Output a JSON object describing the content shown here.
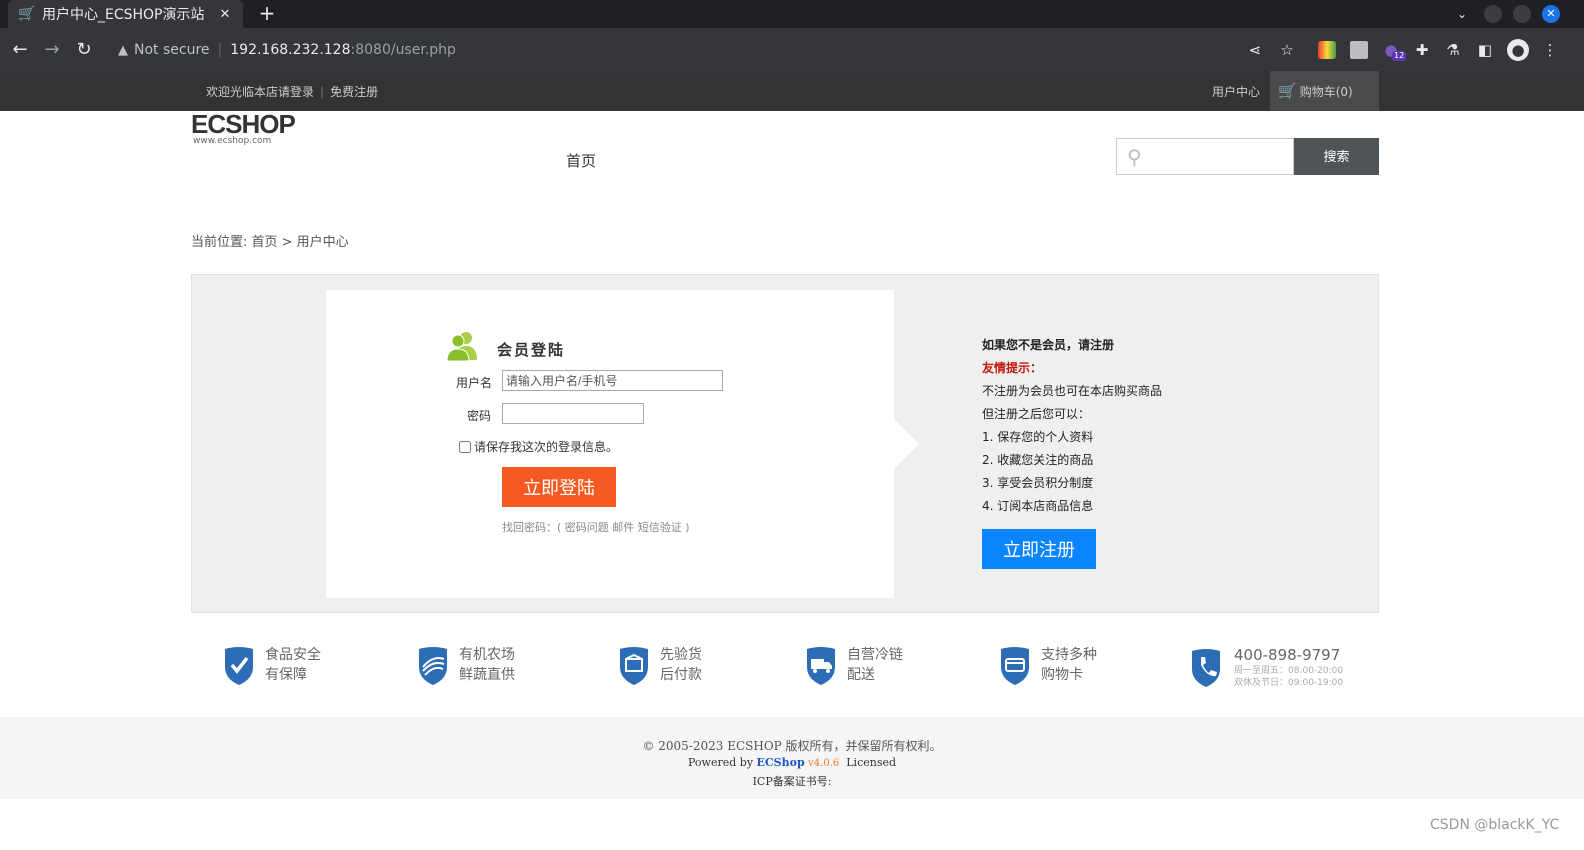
{
  "browser": {
    "tab_title": "用户中心_ECSHOP演示站",
    "security_label": "Not secure",
    "url_host": "192.168.232.128",
    "url_path": ":8080/user.php",
    "extension_badge": "12"
  },
  "site_topbar": {
    "welcome": "欢迎光临本店请登录",
    "register_link": "免费注册",
    "user_center": "用户中心",
    "cart": "购物车(0)"
  },
  "header": {
    "logo_text": "ECSHOP",
    "logo_sub": "www.ecshop.com",
    "nav_home": "首页",
    "search_button": "搜索"
  },
  "breadcrumb": "当前位置: 首页 > 用户中心",
  "login": {
    "title": "会员登陆",
    "username_label": "用户名",
    "username_placeholder": "请输入用户名/手机号",
    "password_label": "密码",
    "remember_label": "请保存我这次的登录信息。",
    "login_button": "立即登陆",
    "forgot": "找回密码：( 密码问题 邮件 短信验证 )"
  },
  "register": {
    "heading": "如果您不是会员，请注册",
    "tip": "友情提示：",
    "lines": [
      "不注册为会员也可在本店购买商品",
      "但注册之后您可以：",
      "1. 保存您的个人资料",
      "2. 收藏您关注的商品",
      "3. 享受会员积分制度",
      "4. 订阅本店商品信息"
    ],
    "button": "立即注册"
  },
  "features": [
    {
      "icon": "check-shield-icon",
      "line1": "食品安全",
      "line2": "有保障"
    },
    {
      "icon": "farm-shield-icon",
      "line1": "有机农场",
      "line2": "鲜蔬直供"
    },
    {
      "icon": "box-shield-icon",
      "line1": "先验货",
      "line2": "后付款"
    },
    {
      "icon": "truck-shield-icon",
      "line1": "自营冷链",
      "line2": "配送"
    },
    {
      "icon": "card-shield-icon",
      "line1": "支持多种",
      "line2": "购物卡"
    }
  ],
  "hotline": {
    "phone": "400-898-9797",
    "hours1": "周一至周五：08:00-20:00",
    "hours2": "双休及节日：09:00-19:00"
  },
  "footer": {
    "copyright": "© 2005-2023 ECSHOP 版权所有，并保留所有权利。",
    "powered_prefix": "Powered by",
    "powered_brand": "ECShop",
    "powered_version": "v4.0.6",
    "powered_suffix": "Licensed",
    "icp": "ICP备案证书号:"
  },
  "watermark": "CSDN @blackK_YC",
  "colors": {
    "accent_login": "#f65a22",
    "accent_register": "#0a84ff",
    "feature_blue": "#2d6db5"
  }
}
